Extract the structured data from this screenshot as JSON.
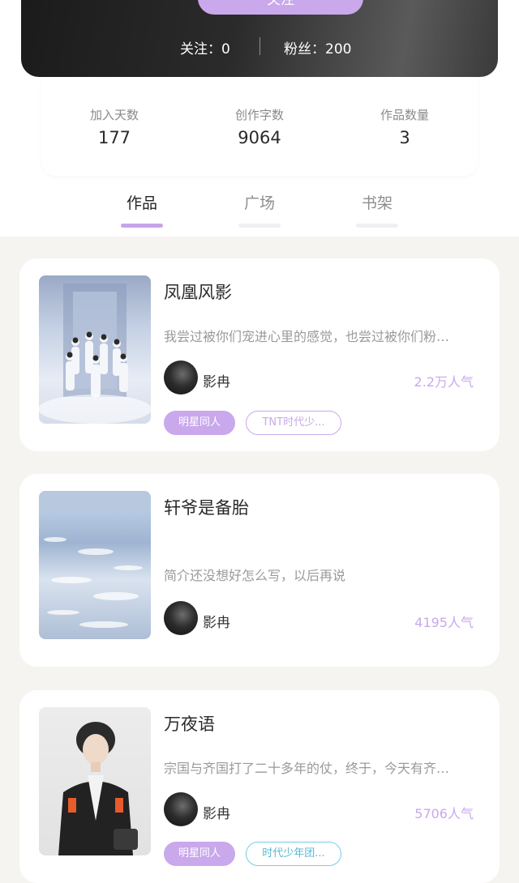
{
  "profile": {
    "follow_button": "关注",
    "following": "关注：0",
    "fans": "粉丝：200"
  },
  "stats": [
    {
      "label": "加入天数",
      "value": "177"
    },
    {
      "label": "创作字数",
      "value": "9064"
    },
    {
      "label": "作品数量",
      "value": "3"
    }
  ],
  "tabs": [
    {
      "label": "作品",
      "active": true
    },
    {
      "label": "广场",
      "active": false
    },
    {
      "label": "书架",
      "active": false
    }
  ],
  "works": [
    {
      "title": "凤凰风影",
      "description": "我尝过被你们宠进心里的感觉，也尝过被你们粉…",
      "author": "影冉",
      "popularity": "2.2万人气",
      "tags": [
        "明星同人",
        "TNT时代少..."
      ]
    },
    {
      "title": "轩爷是备胎",
      "description": "简介还没想好怎么写，以后再说",
      "author": "影冉",
      "popularity": "4195人气",
      "tags": []
    },
    {
      "title": "万夜语",
      "description": "宗国与齐国打了二十多年的仗，终于，今天有齐…",
      "author": "影冉",
      "popularity": "5706人气",
      "tags": [
        "明星同人",
        "时代少年团..."
      ]
    }
  ],
  "colors": {
    "accent": "#c9a8ec",
    "tag_teal": "#5ab8d1",
    "background": "#f5f4f0"
  }
}
